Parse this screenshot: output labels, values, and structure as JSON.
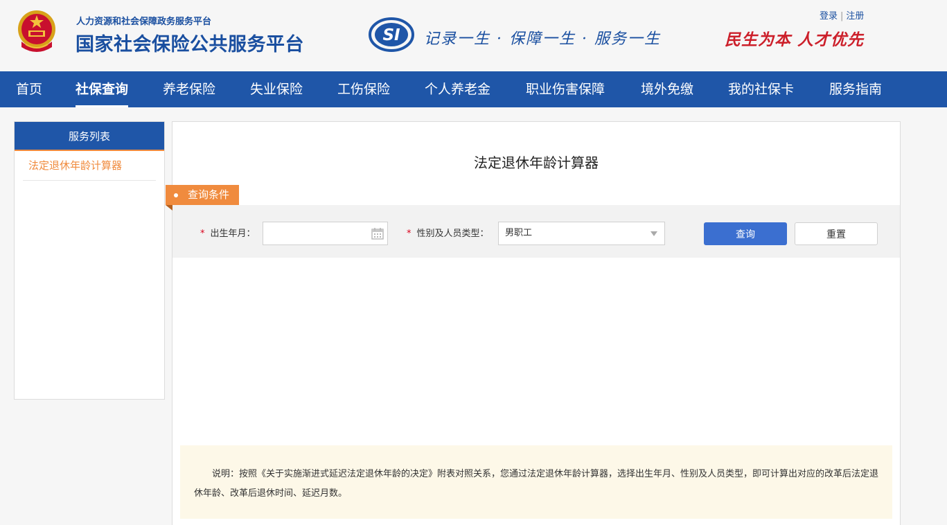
{
  "header": {
    "subtitle": "人力资源和社会保障政务服务平台",
    "title": "国家社会保险公共服务平台",
    "logo_text": "SI",
    "slogan": "记录一生 · 保障一生 · 服务一生",
    "motto": "民生为本 人才优先",
    "login": "登录",
    "register": "注册",
    "separator": "|"
  },
  "nav": {
    "items": [
      {
        "label": "首页"
      },
      {
        "label": "社保查询",
        "active": true
      },
      {
        "label": "养老保险"
      },
      {
        "label": "失业保险"
      },
      {
        "label": "工伤保险"
      },
      {
        "label": "个人养老金"
      },
      {
        "label": "职业伤害保障"
      },
      {
        "label": "境外免缴"
      },
      {
        "label": "我的社保卡"
      },
      {
        "label": "服务指南"
      }
    ]
  },
  "sidebar": {
    "title": "服务列表",
    "items": [
      {
        "label": "法定退休年龄计算器",
        "active": true
      }
    ]
  },
  "main": {
    "title": "法定退休年龄计算器",
    "condition_tag": "查询条件",
    "form": {
      "required_mark": "*",
      "birth_label": "出生年月：",
      "birth_value": "",
      "birth_placeholder": "",
      "type_label": "性别及人员类型：",
      "type_value": "男职工",
      "query_button": "查询",
      "reset_button": "重置"
    },
    "note": "说明：按照《关于实施渐进式延迟法定退休年龄的决定》附表对照关系，您通过法定退休年龄计算器，选择出生年月、性别及人员类型，即可计算出对应的改革后法定退休年龄、改革后退休时间、延迟月数。"
  },
  "colors": {
    "brand_blue": "#1f56a8",
    "accent_orange": "#f08b3e",
    "motto_red": "#cc1f2a",
    "button_blue": "#3b6fd0"
  },
  "icons": {
    "emblem": "national-emblem-icon",
    "si_logo": "si-logo-icon",
    "calendar": "calendar-icon",
    "dropdown": "chevron-down-icon"
  }
}
